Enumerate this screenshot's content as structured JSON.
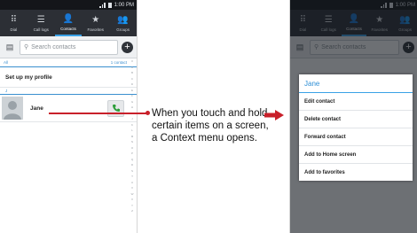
{
  "status_bar": {
    "time": "1:00 PM"
  },
  "tabs": [
    {
      "label": "Dial",
      "icon": "dialpad-icon",
      "glyph": "⠿"
    },
    {
      "label": "Call logs",
      "icon": "call-logs-icon",
      "glyph": "☰"
    },
    {
      "label": "Contacts",
      "icon": "contacts-icon",
      "glyph": "👤"
    },
    {
      "label": "Favorites",
      "icon": "star-icon",
      "glyph": "★"
    },
    {
      "label": "Groups",
      "icon": "groups-icon",
      "glyph": "👥"
    }
  ],
  "search": {
    "placeholder": "Search contacts"
  },
  "section": {
    "label": "All",
    "count": "1 contact"
  },
  "profile": {
    "label": "Set up my profile"
  },
  "letter_header": "J",
  "contact": {
    "name": "Jane"
  },
  "alphabet": [
    "#",
    "A",
    "B",
    "C",
    "D",
    "E",
    "F",
    "G",
    "H",
    "I",
    "J",
    "K",
    "L",
    "M",
    "N",
    "O",
    "P",
    "Q",
    "R",
    "S",
    "T",
    "U",
    "V",
    "W",
    "X",
    "Y",
    "Z"
  ],
  "callout": {
    "text": "When you touch and hold certain items on a screen, a Context menu opens."
  },
  "context_menu": {
    "title": "Jane",
    "items": [
      "Edit contact",
      "Delete contact",
      "Forward contact",
      "Add to Home screen",
      "Add to favorites"
    ]
  },
  "colors": {
    "accent": "#3aa1e6",
    "pointer": "#c9202a",
    "call_green": "#2e9e3a"
  }
}
